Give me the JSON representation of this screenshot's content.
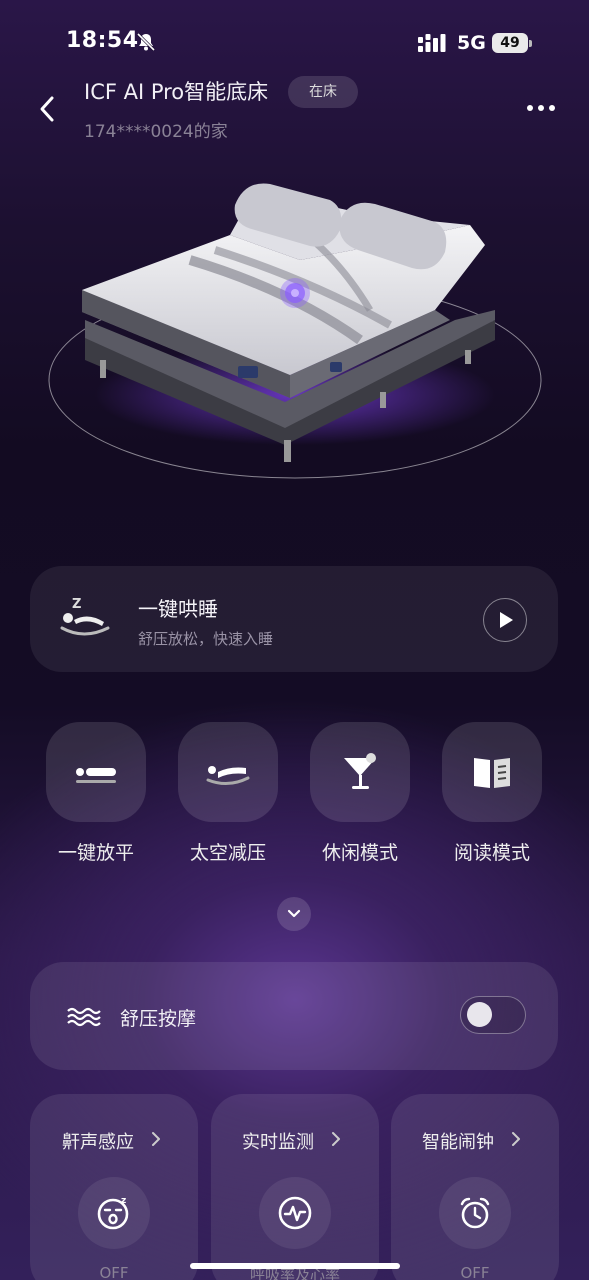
{
  "status_bar": {
    "time": "18:54",
    "network": "5G",
    "battery": "49",
    "icons": [
      "bell-off-icon",
      "signal-icon",
      "battery-icon"
    ]
  },
  "header": {
    "title": "ICF AI Pro智能底床",
    "badge": "在床",
    "subtitle": "174****0024的家",
    "icons": [
      "back-arrow-icon",
      "more-dots-icon"
    ]
  },
  "sleep_card": {
    "title": "一键哄睡",
    "subtitle": "舒压放松，快速入睡",
    "icons": [
      "sleep-icon",
      "play-icon"
    ]
  },
  "modes": [
    {
      "label": "一键放平",
      "icon": "flat-bed-icon"
    },
    {
      "label": "太空减压",
      "icon": "zero-gravity-icon"
    },
    {
      "label": "休闲模式",
      "icon": "cocktail-icon"
    },
    {
      "label": "阅读模式",
      "icon": "book-icon"
    }
  ],
  "massage": {
    "label": "舒压按摩",
    "enabled": false,
    "icon": "wave-icon"
  },
  "features": [
    {
      "title": "鼾声感应",
      "status": "OFF",
      "icon": "snore-face-icon"
    },
    {
      "title": "实时监测",
      "status": "呼吸率及心率",
      "icon": "heartbeat-icon"
    },
    {
      "title": "智能闹钟",
      "status": "OFF",
      "icon": "alarm-clock-icon"
    }
  ],
  "colors": {
    "background_top": "#2a1648",
    "background_glow": "#5a3590",
    "accent": "#8a5cff",
    "card": "rgba(255,255,255,0.07)"
  }
}
